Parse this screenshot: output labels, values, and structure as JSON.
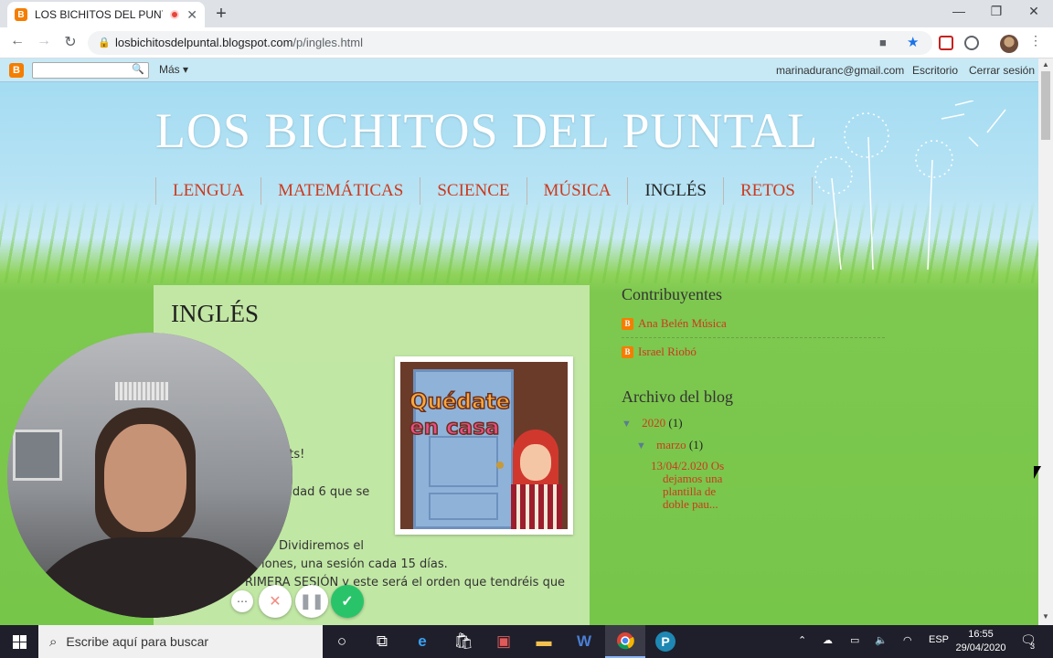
{
  "browser": {
    "tab_title": "LOS BICHITOS DEL PUNTAL",
    "url_domain": "losbichitosdelpuntal.blogspot.com",
    "url_path": "/p/ingles.html"
  },
  "blogger_bar": {
    "more_label": "Más ▾",
    "email": "marinaduranc@gmail.com",
    "desktop": "Escritorio",
    "logout": "Cerrar sesión"
  },
  "blog": {
    "title": "LOS BICHITOS DEL PUNTAL",
    "menu": [
      {
        "label": "LENGUA",
        "active": false
      },
      {
        "label": "MATEMÁTICAS",
        "active": false
      },
      {
        "label": "SCIENCE",
        "active": false
      },
      {
        "label": "MÚSICA",
        "active": false
      },
      {
        "label": "INGLÉS",
        "active": true
      },
      {
        "label": "RETOS",
        "active": false
      }
    ]
  },
  "post": {
    "title": "INGLÉS",
    "image_text_1": "Quédate",
    "image_text_2": "en casa",
    "lines": [
      "nts!",
      "nidad 6 que se",
      "Dividiremos el",
      "iones, una sesión cada 15 días.",
      "PRIMERA SESIÓN  y este será el orden que tendréis que"
    ]
  },
  "sidebar": {
    "contributors_heading": "Contribuyentes",
    "contributors": [
      "Ana Belén Música",
      "Israel Riobó"
    ],
    "archive_heading": "Archivo del blog",
    "year": "2020",
    "year_count": "(1)",
    "month": "marzo",
    "month_count": "(1)",
    "post_link_lines": [
      "13/04/2.020 Os",
      "dejamos una",
      "plantilla de",
      "doble pau..."
    ]
  },
  "taskbar": {
    "search_placeholder": "Escribe aquí para buscar",
    "language": "ESP",
    "time": "16:55",
    "date": "29/04/2020",
    "notifications": "3"
  },
  "colors": {
    "link": "#cc3a1e",
    "blogger_orange": "#f57d00",
    "record_green": "#29c46a"
  }
}
